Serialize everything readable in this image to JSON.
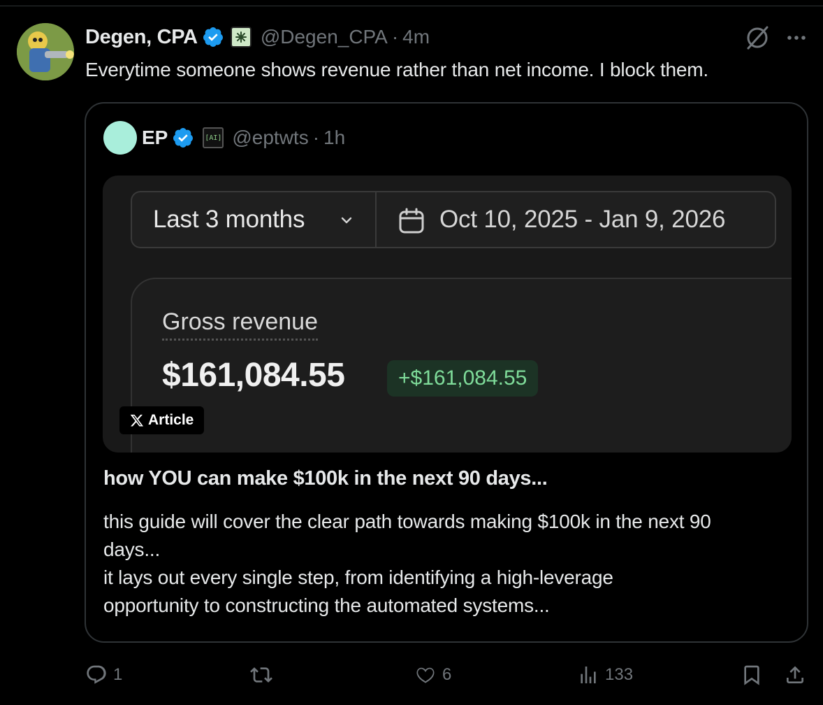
{
  "tweet": {
    "author": {
      "name": "Degen, CPA",
      "handle": "@Degen_CPA",
      "separator": "·",
      "time": "4m"
    },
    "text": "Everytime someone shows revenue rather than net income. I block them."
  },
  "quote": {
    "author": {
      "name": "EP",
      "badge": "[AI]",
      "handle": "@eptwts",
      "separator": "·",
      "time": "1h"
    },
    "image": {
      "range_label": "Last 3 months",
      "date_range": "Oct 10, 2025 - Jan 9, 2026",
      "metric_label": "Gross revenue",
      "metric_value": "$161,084.55",
      "metric_delta": "+$161,084.55"
    },
    "article_badge": "Article",
    "article_title": "how YOU can make $100k in the next 90 days...",
    "article_desc": [
      "this guide will cover the clear path towards making $100k in the next 90",
      "days...",
      "it lays out every single step, from identifying a high-leverage",
      "opportunity to constructing the automated systems..."
    ]
  },
  "actions": {
    "replies": "1",
    "likes": "6",
    "views": "133"
  },
  "colors": {
    "background": "#000000",
    "verified": "#1d9bf0",
    "muted": "#71767b",
    "delta_green": "#7fdc9a"
  }
}
